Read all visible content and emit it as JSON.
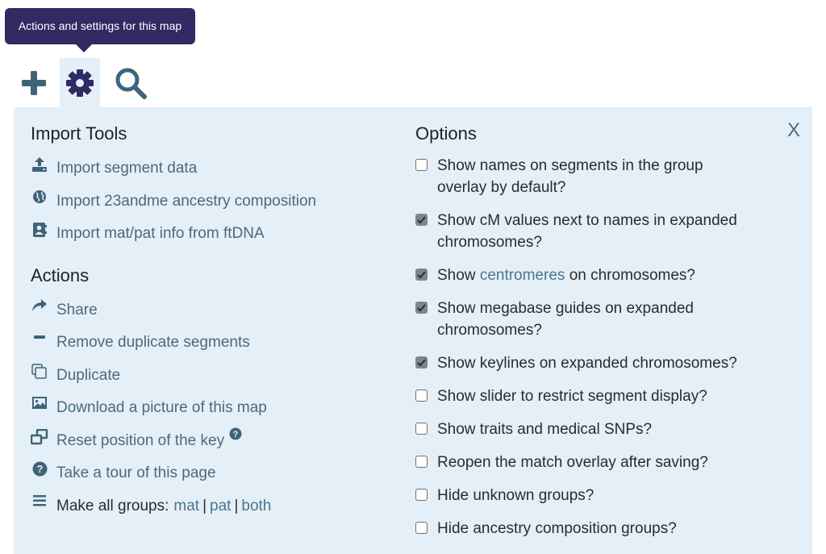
{
  "tooltip": {
    "text": "Actions and settings for this map"
  },
  "toolbar": {
    "tools": [
      {
        "name": "add",
        "icon": "plus-icon"
      },
      {
        "name": "settings",
        "icon": "gear-icon",
        "active": true
      },
      {
        "name": "search",
        "icon": "search-icon"
      }
    ]
  },
  "colors": {
    "accent": "#4a6a80",
    "tooltip_bg": "#312a63",
    "panel_bg": "#e5eff7",
    "gear": "#312a63",
    "checkbox_checked": "#7e868c"
  },
  "import_tools": {
    "heading": "Import Tools",
    "items": [
      {
        "label": "Import segment data",
        "icon": "upload-icon"
      },
      {
        "label": "Import 23andme ancestry composition",
        "icon": "globe-icon"
      },
      {
        "label": "Import mat/pat info from ftDNA",
        "icon": "contact-book-icon"
      }
    ]
  },
  "actions": {
    "heading": "Actions",
    "items": [
      {
        "label": "Share",
        "icon": "share-icon"
      },
      {
        "label": "Remove duplicate segments",
        "icon": "minus-icon"
      },
      {
        "label": "Duplicate",
        "icon": "copy-icon"
      },
      {
        "label": "Download a picture of this map",
        "icon": "image-icon"
      },
      {
        "label": "Reset position of the key",
        "icon": "restore-icon",
        "help": true
      },
      {
        "label": "Take a tour of this page",
        "icon": "question-circle-icon"
      }
    ],
    "groups": {
      "label": "Make all groups:",
      "icon": "menu-icon",
      "options": [
        "mat",
        "pat",
        "both"
      ],
      "separator": "|"
    }
  },
  "options": {
    "heading": "Options",
    "close_label": "X",
    "items": [
      {
        "label": "Show names on segments in the group overlay by default?",
        "checked": false
      },
      {
        "label": "Show cM values next to names in expanded chromosomes?",
        "checked": true
      },
      {
        "label_pre": "Show ",
        "label_link": "centromeres",
        "label_post": " on chromosomes?",
        "checked": true
      },
      {
        "label": "Show megabase guides on expanded chromosomes?",
        "checked": true
      },
      {
        "label": "Show keylines on expanded chromosomes?",
        "checked": true
      },
      {
        "label": "Show slider to restrict segment display?",
        "checked": false
      },
      {
        "label": "Show traits and medical SNPs?",
        "checked": false
      },
      {
        "label": "Reopen the match overlay after saving?",
        "checked": false
      },
      {
        "label": "Hide unknown groups?",
        "checked": false
      },
      {
        "label": "Hide ancestry composition groups?",
        "checked": false
      }
    ]
  }
}
